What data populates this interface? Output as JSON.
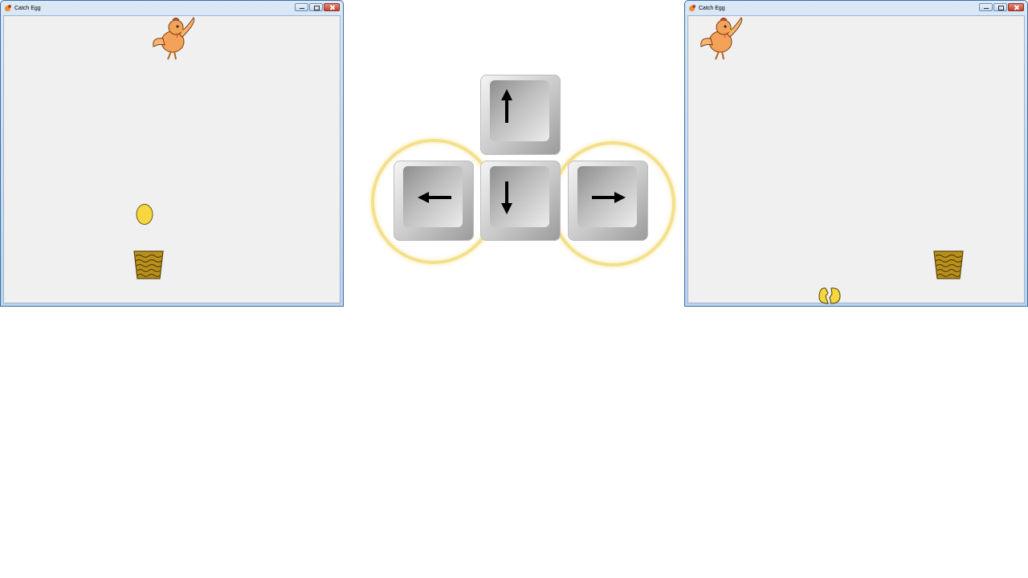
{
  "left_window": {
    "title": "Catch Egg",
    "controls": [
      "minimize",
      "maximize",
      "close"
    ],
    "sprites": [
      "hen-sprite",
      "egg-sprite",
      "basket-sprite"
    ]
  },
  "right_window": {
    "title": "Catch Egg",
    "controls": [
      "minimize",
      "maximize",
      "close"
    ],
    "sprites": [
      "hen-sprite",
      "basket-sprite",
      "broken-egg-sprite"
    ]
  },
  "keys": {
    "up": {
      "icon": "arrow-up-icon",
      "highlighted": false
    },
    "left": {
      "icon": "arrow-left-icon",
      "highlighted": true
    },
    "down": {
      "icon": "arrow-down-icon",
      "highlighted": false
    },
    "right": {
      "icon": "arrow-right-icon",
      "highlighted": true
    }
  },
  "colors": {
    "window_border": "#3a6ea5",
    "client_bg": "#f0f0f0",
    "egg": "#f7d640",
    "basket": "#b8901c",
    "highlight_ring": "#f0d664"
  }
}
